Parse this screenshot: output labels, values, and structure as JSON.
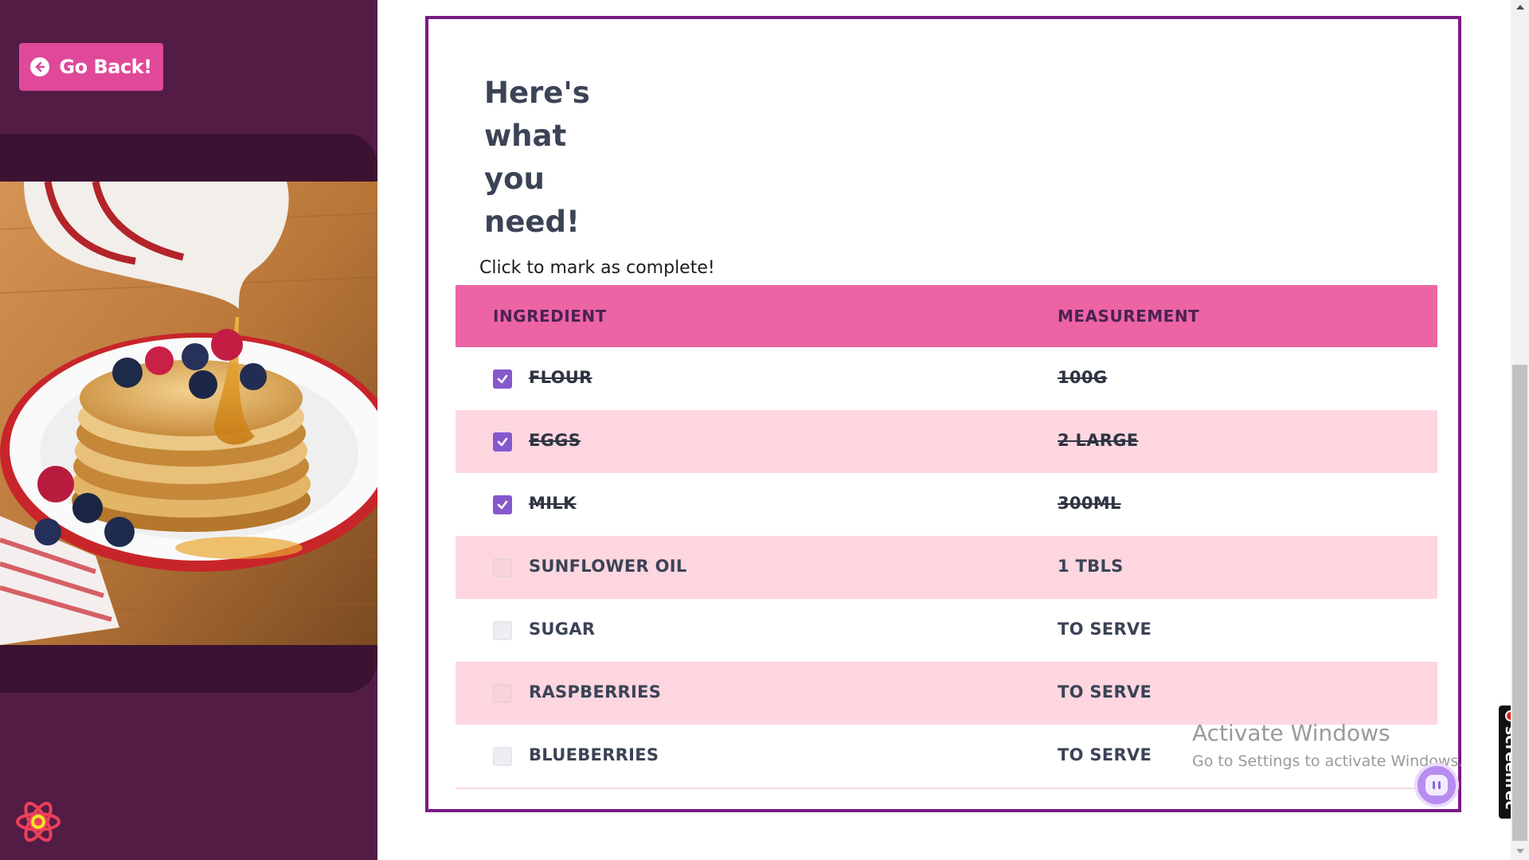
{
  "sidebar": {
    "back_button": {
      "label": "Go Back!",
      "icon": "arrow-left-circle-icon"
    },
    "photo": {
      "subject": "pancakes-with-syrup-and-berries"
    },
    "logo": {
      "icon": "react-logo-icon"
    }
  },
  "main": {
    "heading": "Here's what you need!",
    "subtitle": "Click to mark as complete!",
    "table": {
      "headers": {
        "ingredient": "INGREDIENT",
        "measurement": "MEASUREMENT"
      },
      "rows": [
        {
          "ingredient": "FLOUR",
          "measurement": "100G",
          "checked": true
        },
        {
          "ingredient": "EGGS",
          "measurement": "2 LARGE",
          "checked": true
        },
        {
          "ingredient": "MILK",
          "measurement": "300ML",
          "checked": true
        },
        {
          "ingredient": "SUNFLOWER OIL",
          "measurement": "1 TBLS",
          "checked": false
        },
        {
          "ingredient": "SUGAR",
          "measurement": "TO SERVE",
          "checked": false
        },
        {
          "ingredient": "RASPBERRIES",
          "measurement": "TO SERVE",
          "checked": false
        },
        {
          "ingredient": "BLUEBERRIES",
          "measurement": "TO SERVE",
          "checked": false
        }
      ]
    }
  },
  "overlay": {
    "activate_windows": {
      "title": "Activate Windows",
      "subtitle": "Go to Settings to activate Windows."
    },
    "screenrec_label": "screenrec",
    "chat_icon": "chat-bubble-icon"
  },
  "colors": {
    "sidebar_bg": "#531c45",
    "button_pink": "#e04899",
    "card_border": "#7b1a82",
    "header_pink": "#ec64a4",
    "row_alt_pink": "#fdd6e0",
    "checkbox_purple": "#8658ce",
    "text_dark": "#3b4356"
  }
}
